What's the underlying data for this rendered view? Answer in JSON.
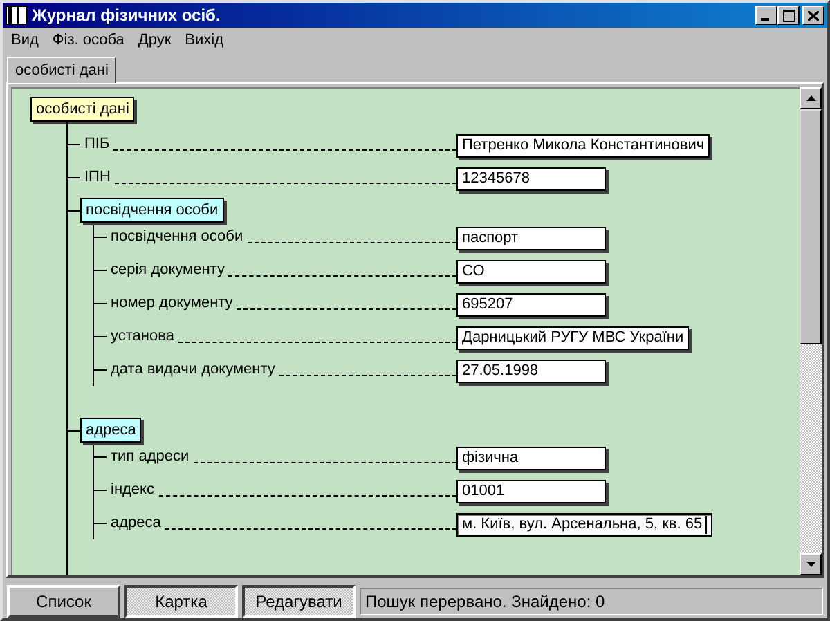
{
  "window": {
    "title": "Журнал фізичних осіб."
  },
  "menu": [
    "Вид",
    "Фіз. особа",
    "Друк",
    "Вихід"
  ],
  "tabs": [
    {
      "label": "особисті дані",
      "selected": true
    }
  ],
  "tree": {
    "label": "особисті дані",
    "children": [
      {
        "kind": "field",
        "label": "ПІБ",
        "value": "Петренко Микола Константинович",
        "focused": false
      },
      {
        "kind": "field",
        "label": "ІПН",
        "value": "12345678",
        "focused": false
      },
      {
        "kind": "group",
        "label": "посвідчення особи",
        "children": [
          {
            "kind": "field",
            "label": "посвідчення особи",
            "value": "паспорт",
            "focused": false
          },
          {
            "kind": "field",
            "label": "серія документу",
            "value": "СО",
            "focused": false
          },
          {
            "kind": "field",
            "label": "номер документу",
            "value": "695207",
            "focused": false
          },
          {
            "kind": "field",
            "label": "установа",
            "value": "Дарницький РУГУ МВС України",
            "focused": false
          },
          {
            "kind": "field",
            "label": "дата видачи документу",
            "value": "27.05.1998",
            "focused": false
          }
        ]
      },
      {
        "kind": "group",
        "label": "адреса",
        "children": [
          {
            "kind": "field",
            "label": "тип адреси",
            "value": "фізична",
            "focused": false
          },
          {
            "kind": "field",
            "label": "індекс",
            "value": "01001",
            "focused": false
          },
          {
            "kind": "field",
            "label": "адреса",
            "value": "м. Київ, вул. Арсенальна, 5, кв. 65",
            "focused": true
          }
        ]
      }
    ]
  },
  "buttons": [
    {
      "label": "Список",
      "pressed": false
    },
    {
      "label": "Картка",
      "pressed": true
    },
    {
      "label": "Редагувати",
      "pressed": true
    }
  ],
  "status_bar": "Пошук перервано. Знайдено: 0"
}
